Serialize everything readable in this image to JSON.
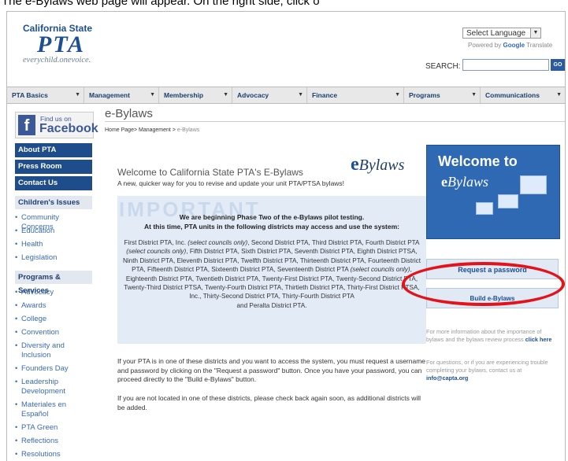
{
  "instruction": "The e-Bylaws web page will appear. On the right side, click o",
  "header": {
    "logo": {
      "line1": "California State",
      "line2": "PTA",
      "tagline": "everychild.onevoice."
    },
    "language_select": "Select Language",
    "powered_by": "Powered by",
    "google": "Google",
    "translate": "Translate",
    "search_label": "SEARCH:",
    "search_placeholder": "",
    "go_label": "GO"
  },
  "nav": {
    "items": [
      {
        "label": "PTA Basics"
      },
      {
        "label": "Management"
      },
      {
        "label": "Membership"
      },
      {
        "label": "Advocacy"
      },
      {
        "label": "Finance"
      },
      {
        "label": "Programs"
      },
      {
        "label": "Communications"
      }
    ]
  },
  "sidebar": {
    "facebook": {
      "line1": "Find us on",
      "line2": "Facebook"
    },
    "buttons": [
      "About PTA",
      "Press Room",
      "Contact Us"
    ],
    "childrens_issues": {
      "heading": "Children's Issues",
      "links": [
        "Community Concerns",
        "Education",
        "Health",
        "Legislation"
      ]
    },
    "programs": {
      "heading": "Programs & Services",
      "links": [
        "Advocacy",
        "Awards",
        "College",
        "Convention",
        "Diversity and Inclusion",
        "Founders Day",
        "Leadership Development",
        "Materiales en Español",
        "PTA Green",
        "Reflections",
        "Resolutions"
      ]
    }
  },
  "main": {
    "page_title": "e-Bylaws",
    "breadcrumb": {
      "home": "Home Page",
      "section": "Management",
      "current": "e-Bylaws"
    },
    "welcome_title": "Welcome to California State PTA's E-Bylaws",
    "welcome_sub": "A new, quicker way for you to revise and update your unit PTA/PTSA bylaws!",
    "ebylaws_logo": {
      "e": "e",
      "rest": "Bylaws"
    },
    "important": {
      "word": "IMPORTANT",
      "line1": "We are beginning Phase Two of the e-Bylaws pilot testing.",
      "line2": "At this time, PTA units in the following districts may access and use the system:",
      "districts_a": "First District PTA, Inc. ",
      "districts_a_italic": "(select councils only)",
      "districts_b": ", Second District PTA, Third District PTA, Fourth District PTA ",
      "districts_b_italic": "(select councils only)",
      "districts_c": ", Fifth District PTA, Sixth District PTA, Seventh District PTA, Eighth District PTSA, Ninth District PTA, Eleventh District PTA, Twelfth District PTA, Thirteenth District PTA, Fourteenth District PTA, Fifteenth District PTA, Sixteenth District PTA, Seventeenth District PTA ",
      "districts_c_italic": "(select councils only)",
      "districts_d": ", Eighteenth District PTA, Twentieth District PTA, Twenty-First District PTA, Twenty-Second District PTA, Twenty-Third District PTSA, Twenty-Fourth District PTA, Thirtieth District PTA, Thirty-First District PTSA, Inc., Thirty-Second District PTA, Thirty-Fourth District PTA",
      "districts_end": "and Peralta District PTA."
    },
    "para1": "If your PTA is in one of these districts and you want to access the system, you must request a username and password by clicking on the \"Request a password\" button. Once you have your password, you can proceed directly to the \"Build e-Bylaws\" button.",
    "para2": "If you are not located in one of these districts, please check back again soon, as additional districts will be added."
  },
  "right": {
    "banner_title": "Welcome to",
    "banner_sub": "Bylaws",
    "banner_e": "e",
    "request_button": "Request a password",
    "build_button": "Build e-Bylaws",
    "info1_text": "For more information about the importance of bylaws and the bylaws review process ",
    "info1_link": "click here",
    "info2_text": "For questions, or if you are experiencing trouble completing your bylaws, contact us at ",
    "info2_link": "info@capta.org"
  },
  "colors": {
    "accent": "#1f4d8c",
    "highlight": "#e2131b"
  }
}
